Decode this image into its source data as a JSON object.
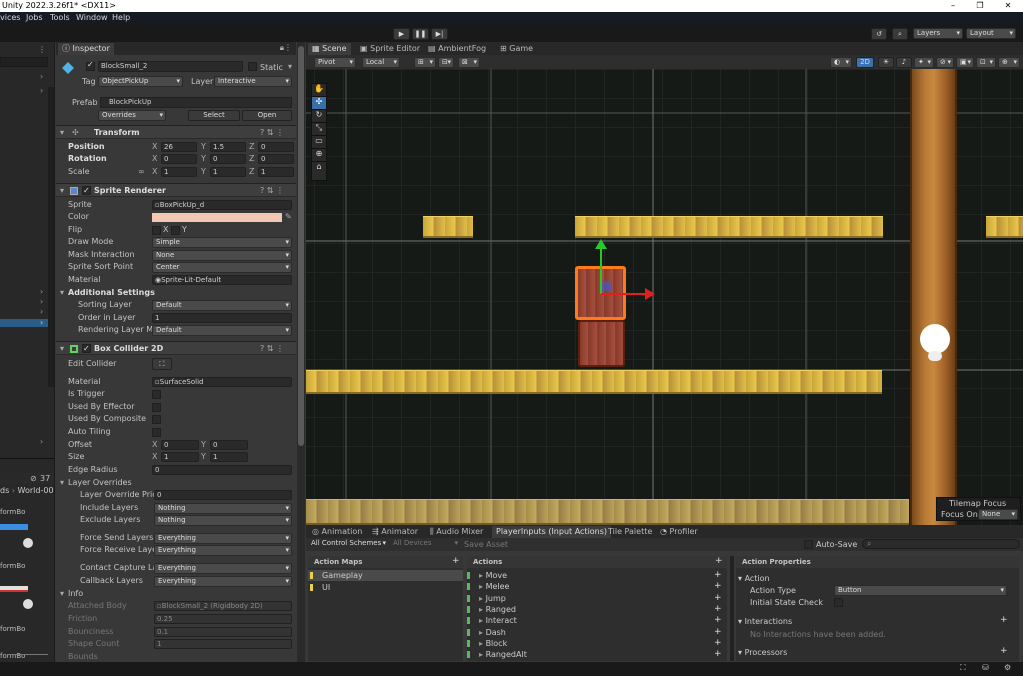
{
  "window": {
    "title": "Unity 2022.3.26f1* <DX11>",
    "buttons": [
      "–",
      "❐",
      "✕"
    ]
  },
  "menu": {
    "items": [
      "vices",
      "Jobs",
      "Tools",
      "Window",
      "Help"
    ]
  },
  "toolbar": {
    "layers": "Layers",
    "layout": "Layout"
  },
  "hierarchy": {
    "count": "37",
    "world": "World-00",
    "items": [
      "formBo",
      "formBo",
      "formBo"
    ],
    "prefix": "ds"
  },
  "inspector": {
    "tab": "Inspector",
    "object_name": "BlockSmall_2",
    "static_label": "Static",
    "tag_label": "Tag",
    "tag_value": "ObjectPickUp",
    "layer_label": "Layer",
    "layer_value": "Interactive",
    "prefab_label": "Prefab",
    "prefab_value": "BlockPickUp",
    "overrides": "Overrides",
    "select": "Select",
    "open": "Open",
    "transform": {
      "title": "Transform",
      "position_label": "Position",
      "rotation_label": "Rotation",
      "scale_label": "Scale",
      "position": {
        "x": "26",
        "y": "1.5",
        "z": "0"
      },
      "rotation": {
        "x": "0",
        "y": "0",
        "z": "0"
      },
      "scale": {
        "x": "1",
        "y": "1",
        "z": "1"
      }
    },
    "sprite_renderer": {
      "title": "Sprite Renderer",
      "sprite_label": "Sprite",
      "sprite": "BoxPickUp_d",
      "color_label": "Color",
      "color": "#f0c8b4",
      "flip_label": "Flip",
      "flip_x": "X",
      "flip_y": "Y",
      "draw_mode_label": "Draw Mode",
      "draw_mode": "Simple",
      "mask_label": "Mask Interaction",
      "mask": "None",
      "sort_point_label": "Sprite Sort Point",
      "sort_point": "Center",
      "material_label": "Material",
      "material": "Sprite-Lit-Default",
      "additional": "Additional Settings",
      "sorting_layer_label": "Sorting Layer",
      "sorting_layer": "Default",
      "order_label": "Order in Layer",
      "order": "1",
      "rendering_layer_label": "Rendering Layer Mas",
      "rendering_layer": "Default"
    },
    "box_collider": {
      "title": "Box Collider 2D",
      "edit_label": "Edit Collider",
      "material_label": "Material",
      "material": "SurfaceSolid",
      "trigger_label": "Is Trigger",
      "effector_label": "Used By Effector",
      "composite_label": "Used By Composite",
      "tiling_label": "Auto Tiling",
      "offset_label": "Offset",
      "offset": {
        "x": "0",
        "y": "0"
      },
      "size_label": "Size",
      "size": {
        "x": "1",
        "y": "1"
      },
      "edge_label": "Edge Radius",
      "edge": "0",
      "layer_overrides": "Layer Overrides",
      "priority_label": "Layer Override Priori",
      "priority": "0",
      "include_label": "Include Layers",
      "include": "Nothing",
      "exclude_label": "Exclude Layers",
      "exclude": "Nothing",
      "force_send_label": "Force Send Layers",
      "force_send": "Everything",
      "force_receive_label": "Force Receive Layer",
      "force_receive": "Everything",
      "contact_label": "Contact Capture Lay",
      "contact": "Everything",
      "callback_label": "Callback Layers",
      "callback": "Everything",
      "info": "Info",
      "attached_label": "Attached Body",
      "attached": "BlockSmall_2 (Rigidbody 2D)",
      "friction_label": "Friction",
      "friction": "0.25",
      "bounciness_label": "Bounciness",
      "bounciness": "0.1",
      "shape_label": "Shape Count",
      "shape": "1",
      "bounds_label": "Bounds"
    }
  },
  "scene": {
    "tabs": [
      "Scene",
      "Sprite Editor",
      "AmbientFog",
      "Game"
    ],
    "pivot": "Pivot",
    "local": "Local",
    "mode2d": "2D",
    "tilemap_focus": "Tilemap Focus",
    "focus_on_label": "Focus On",
    "focus_on": "None"
  },
  "bottom": {
    "tabs": [
      "Animation",
      "Animator",
      "Audio Mixer",
      "PlayerInputs (Input Actions)",
      "Tile Palette",
      "Profiler"
    ],
    "control_schemes": "All Control Schemes",
    "devices": "All Devices",
    "save_asset": "Save Asset",
    "auto_save": "Auto-Save",
    "action_maps_title": "Action Maps",
    "action_maps": [
      "Gameplay",
      "UI"
    ],
    "actions_title": "Actions",
    "actions": [
      "Move",
      "Melee",
      "Jump",
      "Ranged",
      "Interact",
      "Dash",
      "Block",
      "RangedAlt"
    ],
    "properties_title": "Action Properties",
    "action_section": "Action",
    "action_type_label": "Action Type",
    "action_type": "Button",
    "initial_state_label": "Initial State Check",
    "interactions_section": "Interactions",
    "no_interactions": "No Interactions have been added.",
    "processors_section": "Processors"
  }
}
